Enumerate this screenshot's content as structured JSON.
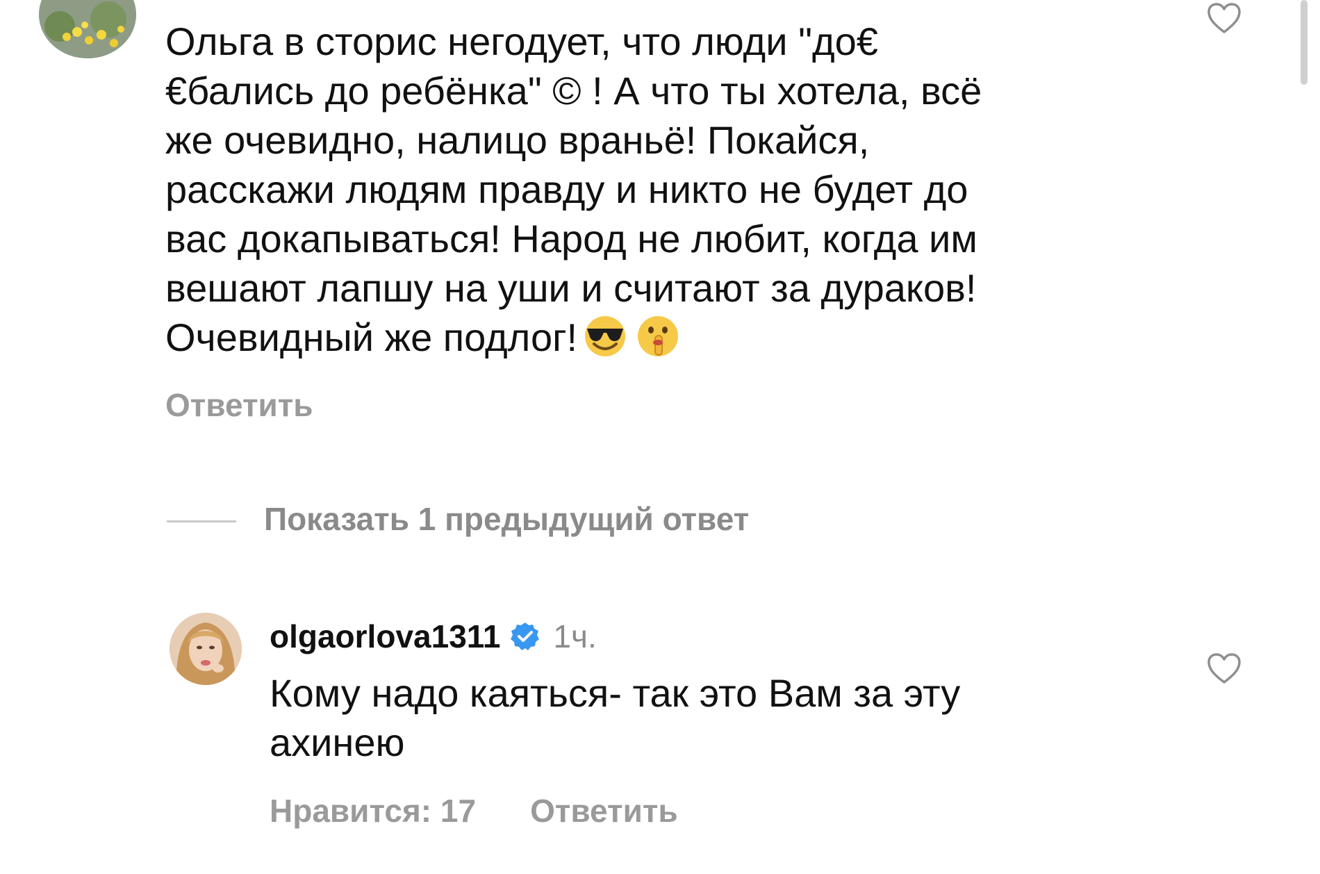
{
  "comment": {
    "text": "Ольга в сторис негодует, что люди \"до€\n€бались до ребёнка\" © ! А что ты хотела, всё\nже очевидно, налицо враньё! Покайся,\nрасскажи людям правду и никто не будет до\nвас докапываться! Народ не любит, когда им\nвешают лапшу на уши и считают за дураков!\nОчевидный же подлог!",
    "emoji_1": "smiling-face-with-sunglasses",
    "emoji_2": "shushing-face",
    "reply_label": "Ответить",
    "like_icon": "heart-outline-icon"
  },
  "thread": {
    "show_previous_label": "Показать 1 предыдущий ответ"
  },
  "reply": {
    "username": "olgaorlova1311",
    "verified": true,
    "time": "1ч.",
    "text": "Кому надо каяться- так это Вам за эту\nахинею",
    "likes_label": "Нравится: 17",
    "reply_label": "Ответить",
    "like_icon": "heart-outline-icon"
  },
  "colors": {
    "text": "#111111",
    "muted": "#9a9a9a",
    "verified_badge": "#3897f0"
  }
}
